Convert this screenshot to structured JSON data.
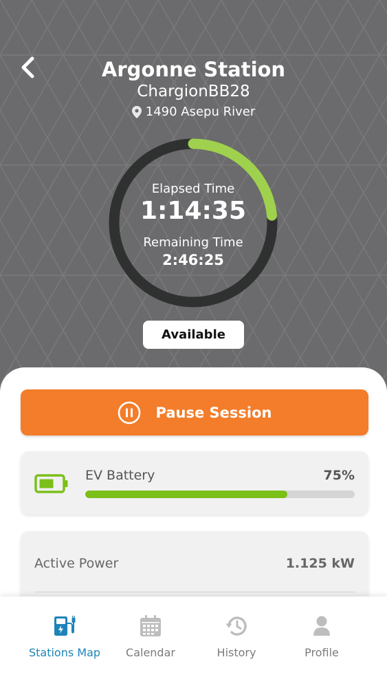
{
  "header": {
    "back_icon": "chevron-left-icon",
    "station_name": "Argonne Station",
    "charger_id": "ChargionBB28",
    "address_icon": "map-pin-icon",
    "address": "1490 Asepu River"
  },
  "session": {
    "elapsed_label": "Elapsed Time",
    "elapsed_value": "1:14:35",
    "remaining_label": "Remaining Time",
    "remaining_value": "2:46:25",
    "progress_fraction": 0.235,
    "ring_color": "#9fd14e",
    "ring_track_color": "#2f3131"
  },
  "status": {
    "label": "Available"
  },
  "actions": {
    "pause_label": "Pause Session",
    "pause_icon": "pause-circle-icon",
    "pause_color": "#f37d2a"
  },
  "battery": {
    "icon": "battery-icon",
    "label": "EV Battery",
    "percent_label": "75%",
    "level_fraction": 0.75,
    "fill_color": "#7bbf19"
  },
  "power": {
    "label": "Active Power",
    "value": "1.125 kW"
  },
  "nav": {
    "items": [
      {
        "label": "Stations Map",
        "icon": "ev-charger-icon",
        "active": true
      },
      {
        "label": "Calendar",
        "icon": "calendar-icon",
        "active": false
      },
      {
        "label": "History",
        "icon": "history-icon",
        "active": false
      },
      {
        "label": "Profile",
        "icon": "user-icon",
        "active": false
      }
    ],
    "active_color": "#1e84b8",
    "inactive_color": "#bdbdbd"
  }
}
